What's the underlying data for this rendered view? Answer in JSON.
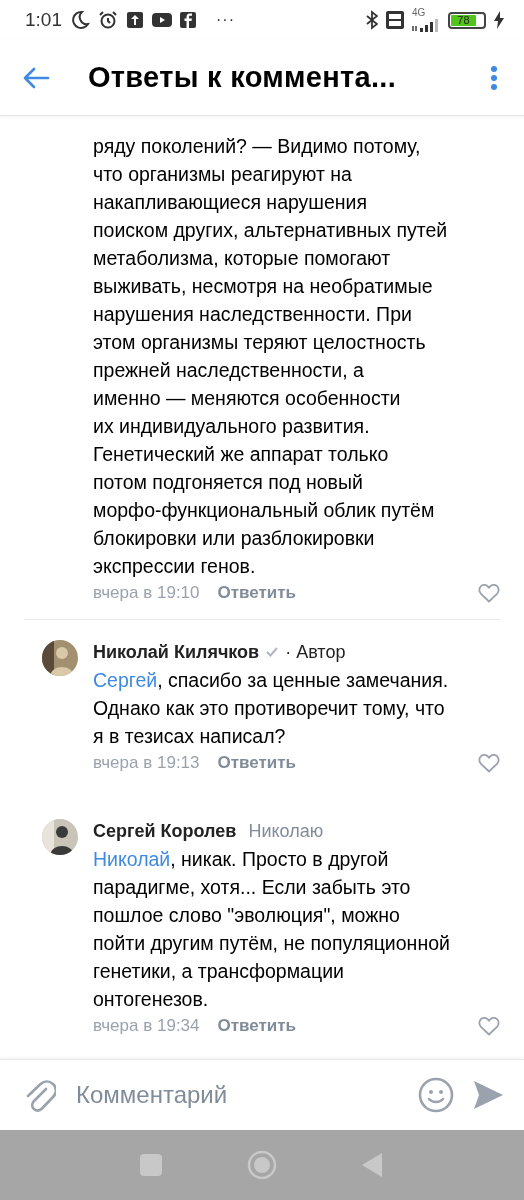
{
  "status_bar": {
    "time": "1:01",
    "more": "···",
    "network": "4G",
    "battery": "78"
  },
  "header": {
    "title": "Ответы к коммента..."
  },
  "comments": [
    {
      "text": "ряду поколений? — Видимо потому,\nчто организмы реагируют на\nнакапливающиеся нарушения\nпоиском других, альтернативных путей\nметаболизма, которые помогают\nвыживать, несмотря на необратимые\nнарушения наследственности. При\nэтом организмы теряют целостность\nпрежней наследственности, а\nименно — меняются особенности\nих индивидуального развития.\nГенетический же аппарат только\nпотом подгоняется под новый\nморфо-функциональный облик путём\nблокировки или разблокировки\nэкспрессии генов.",
      "time": "вчера в 19:10",
      "reply": "Ответить",
      "liked": false
    },
    {
      "author": "Николай Килячков",
      "verified": true,
      "role": "· Автор",
      "mention": "Сергей",
      "text": ", спасибо за ценные замечания.\nОднако как это противоречит тому, что\nя в тезисах написал?",
      "time": "вчера в 19:13",
      "reply": "Ответить",
      "liked": false
    },
    {
      "author": "Сергей Королев",
      "verified": false,
      "reply_to": "Николаю",
      "mention": "Николай",
      "text": ", никак. Просто в другой\nпарадигме, хотя... Если забыть это\nпошлое слово \"эволюция\", можно\nпойти другим путём, не популяционной\nгенетики, а трансформации\nонтогенезов.",
      "time": "вчера в 19:34",
      "reply": "Ответить",
      "liked": false
    }
  ],
  "composer": {
    "placeholder": "Комментарий"
  }
}
